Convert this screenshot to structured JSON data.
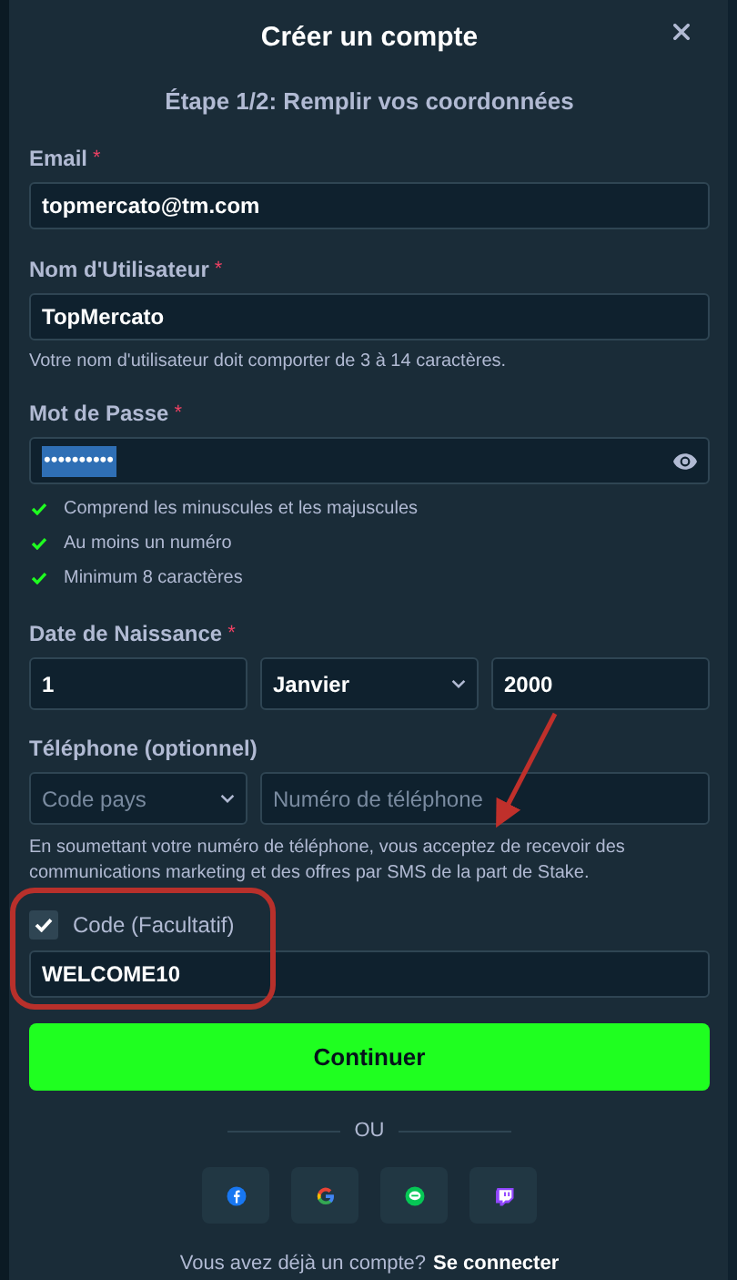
{
  "dialog": {
    "title": "Créer un compte",
    "step": "Étape 1/2: Remplir vos coordonnées"
  },
  "email": {
    "label": "Email",
    "required_mark": "*",
    "value": "topmercato@tm.com"
  },
  "username": {
    "label": "Nom d'Utilisateur",
    "required_mark": "*",
    "value": "TopMercato",
    "hint": "Votre nom d'utilisateur doit comporter de 3 à 14 caractères."
  },
  "password": {
    "label": "Mot de Passe",
    "required_mark": "*",
    "value": "••••••••••",
    "rules": [
      {
        "text": "Comprend les minuscules et les majuscules",
        "met": true
      },
      {
        "text": "Au moins un numéro",
        "met": true
      },
      {
        "text": "Minimum 8 caractères",
        "met": true
      }
    ]
  },
  "birth_date": {
    "label": "Date de Naissance",
    "required_mark": "*",
    "day": "1",
    "month": "Janvier",
    "year": "2000"
  },
  "phone": {
    "label": "Téléphone (optionnel)",
    "country_placeholder": "Code pays",
    "number_placeholder": "Numéro de téléphone",
    "notice": "En soumettant votre numéro de téléphone, vous acceptez de recevoir des communications marketing et des offres par SMS de la part de Stake."
  },
  "code": {
    "label": "Code (Facultatif)",
    "checked": true,
    "value": "WELCOME10"
  },
  "continue_button": "Continuer",
  "divider": "OU",
  "social": [
    {
      "kind": "facebook"
    },
    {
      "kind": "google"
    },
    {
      "kind": "line"
    },
    {
      "kind": "twitch"
    }
  ],
  "footer": {
    "text": "Vous avez déjà un compte?",
    "link": "Se connecter"
  }
}
